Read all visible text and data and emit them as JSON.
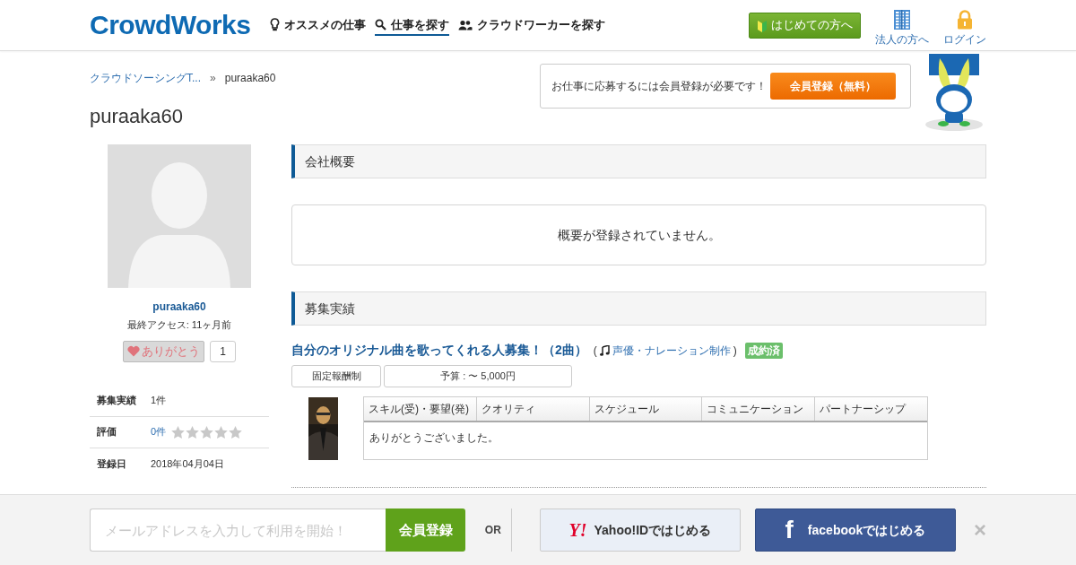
{
  "header": {
    "logo": "CrowdWorks",
    "nav": [
      {
        "label": "オススメの仕事",
        "selected": false
      },
      {
        "label": "仕事を探す",
        "selected": true
      },
      {
        "label": "クラウドワーカーを探す",
        "selected": false
      }
    ],
    "beginner_button": "はじめての方へ",
    "links": [
      {
        "label": "法人の方へ"
      },
      {
        "label": "ログイン"
      }
    ]
  },
  "breadcrumb": [
    {
      "label": "クラウドソーシングT..."
    },
    {
      "label": "puraaka60"
    }
  ],
  "breadcrumb_separator": "»",
  "title": "puraaka60",
  "signup_callout": {
    "text": "お仕事に応募するには会員登録が必要です！",
    "button": "会員登録（無料）"
  },
  "profile": {
    "name": "puraaka60",
    "last_access": "最終アクセス: 11ヶ月前",
    "thanks": {
      "label": "ありがとう",
      "count": "1"
    },
    "stats": [
      {
        "label": "募集実績",
        "value": "1件",
        "kind": "text"
      },
      {
        "label": "評価",
        "value": "0件",
        "kind": "rating",
        "stars": 0
      },
      {
        "label": "登録日",
        "value": "2018年04月04日",
        "kind": "text"
      }
    ]
  },
  "company_overview": {
    "heading": "会社概要",
    "message": "概要が登録されていません。"
  },
  "history": {
    "heading": "募集実績",
    "jobs": [
      {
        "title": "自分のオリジナル曲を歌ってくれる人募集！（2曲）",
        "category_open": "(",
        "category": "声優・ナレーション制作",
        "category_close": ")",
        "status": "成約済",
        "tags": [
          "固定報酬制",
          "予算 : 〜 5,000円"
        ],
        "review": {
          "columns": [
            "スキル(受)・要望(発)",
            "クオリティ",
            "スケジュール",
            "コミュニケーション",
            "パートナーシップ"
          ],
          "comment": "ありがとうございました。"
        }
      }
    ]
  },
  "bottom_bar": {
    "email_placeholder": "メールアドレスを入力して利用を開始！",
    "signup_button": "会員登録",
    "or": "OR",
    "yahoo_logo": "Y!",
    "yahoo_button": "Yahoo!IDではじめる",
    "facebook_logo": "f",
    "facebook_button": "facebookではじめる",
    "close": "×"
  }
}
